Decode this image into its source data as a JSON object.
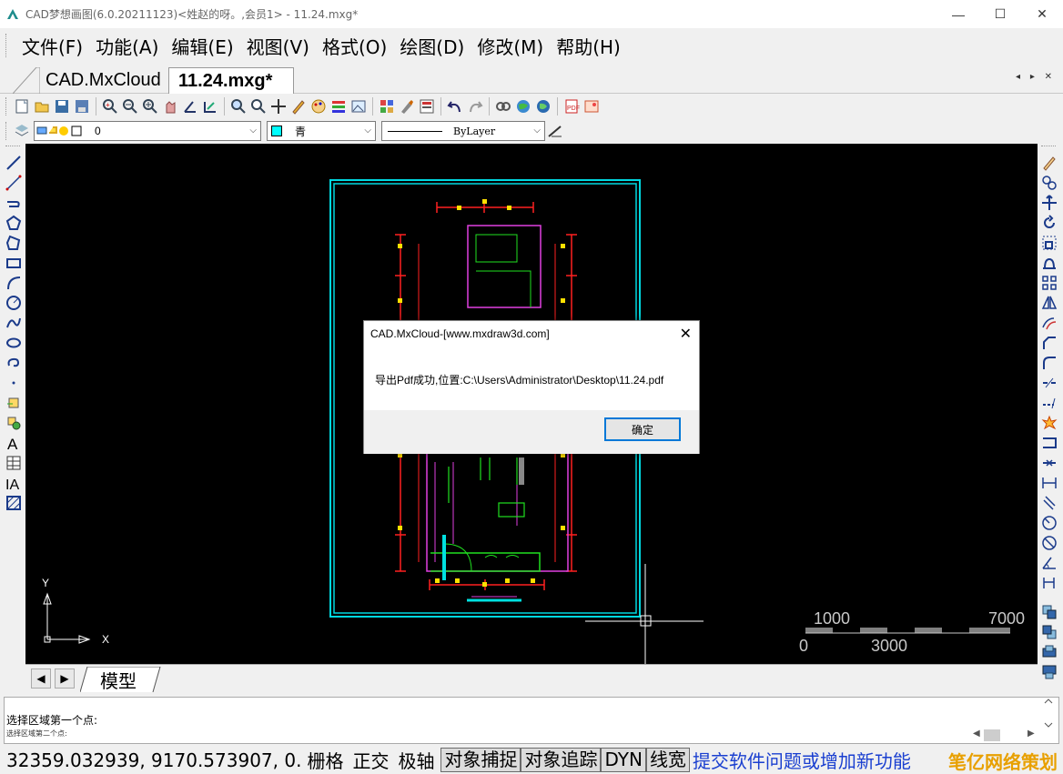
{
  "window": {
    "title": "CAD梦想画图(6.0.20211123)<姓赵的呀。,会员1> - 11.24.mxg*",
    "minimize": "—",
    "maximize": "☐",
    "close": "✕"
  },
  "menu": {
    "items": [
      "文件(F)",
      "功能(A)",
      "编辑(E)",
      "视图(V)",
      "格式(O)",
      "绘图(D)",
      "修改(M)",
      "帮助(H)"
    ]
  },
  "tabs": {
    "inactive": "CAD.MxCloud",
    "active": "11.24.mxg*",
    "arrows": "◂ ▸ ✕"
  },
  "properties": {
    "layer": "0",
    "color": "青",
    "linetype": "ByLayer",
    "color_hex": "#00ffff"
  },
  "canvas": {
    "axis_y": "Y",
    "axis_x": "X",
    "scale_1000": "1000",
    "scale_7000": "7000",
    "scale_0": "0",
    "scale_3000": "3000"
  },
  "model_tab": "模型",
  "command": {
    "line1": "选择区域第一个点:",
    "line2": "选择区域第二个点:"
  },
  "status": {
    "coords": "32359.032939,  9170.573907,  0.",
    "grid": "栅格",
    "ortho": "正交",
    "polar": "极轴",
    "osnap": "对象捕捉",
    "otrack": "对象追踪",
    "dyn": "DYN",
    "lweight": "线宽",
    "feedback": "提交软件问题或增加新功能",
    "watermark": "笔亿网络策划"
  },
  "dialog": {
    "title": "CAD.MxCloud-[www.mxdraw3d.com]",
    "message": "导出Pdf成功,位置:C:\\Users\\Administrator\\Desktop\\11.24.pdf",
    "ok": "确定",
    "close": "✕"
  }
}
